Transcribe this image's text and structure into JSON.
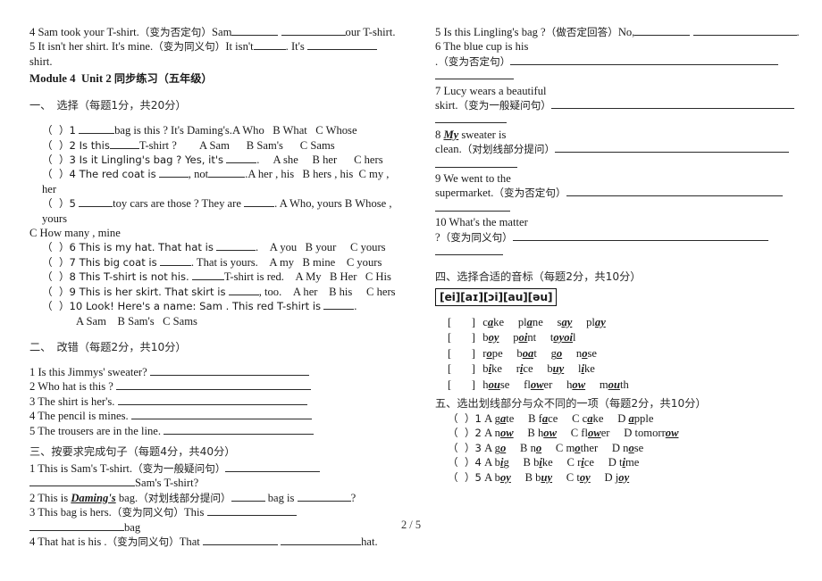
{
  "document": {
    "footer": "2 / 5",
    "title": {
      "module": "Module 4  Unit 2 ",
      "module_cn": "同步练习（五年级）"
    }
  },
  "carryover": {
    "item4": {
      "text_a": "4 Sam took your T-shirt.",
      "cn": "（变为否定句）",
      "text_b": "Sam",
      "text_c": "our T-shirt."
    },
    "item5": {
      "text_a": "5 It isn't her shirt. It's mine.",
      "cn": "（变为同义句）",
      "text_b": "It isn't",
      "text_c": ". It's",
      "text_d": "shirt."
    }
  },
  "section_one": {
    "heading_cn": "一、",
    "heading_title_cn": "选择（每题1分，共20分）",
    "items": [
      {
        "prefix": "（  ）1",
        "stem_a": "bag is this ? It's Daming's.",
        "options": "A Who   B What   C Whose"
      },
      {
        "prefix": "（  ）2 Is this",
        "stem_a": "T-shirt ?",
        "options": "A Sam      B Sam's      C Sams"
      },
      {
        "prefix": "（  ）3 Is it Lingling's bag ? Yes, it's",
        "stem_a": ".",
        "options": "A she     B her      C hers"
      },
      {
        "prefix": "（  ）4 The red coat is",
        "stem_a": ", not",
        "stem_b": ".",
        "options": "A her , his   B hers , his  C my , her"
      },
      {
        "prefix": "（  ）5",
        "stem_a": "toy cars are those ? They are",
        "stem_b": ".",
        "options": "A Who, yours B Whose , yours",
        "options_wrap": "C How many , mine"
      },
      {
        "prefix": "（  ）6 This is my hat. That hat is",
        "stem_a": ".",
        "options": "A you   B your     C yours"
      },
      {
        "prefix": "（  ）7 This big coat is",
        "stem_a": ". That is yours.",
        "options": "A my   B mine    C yours"
      },
      {
        "prefix": "（  ）8 This T-shirt is not his.",
        "stem_a": "T-shirt is red.",
        "options": "A My   B Her   C His"
      },
      {
        "prefix": "（  ）9 This is her skirt. That skirt is",
        "stem_a": ", too.",
        "options": "A her    B his     C hers"
      },
      {
        "prefix": "（  ）10 Look! Here's a name: Sam . This red T-shirt is",
        "stem_a": ".",
        "options": "A Sam    B Sam's   C Sams"
      }
    ]
  },
  "section_two": {
    "heading_cn": "二、",
    "heading_title_cn": "改错（每题2分，共10分）",
    "items": [
      "1 Is this Jimmys' sweater?",
      "2 Who hat is this ?",
      "3 The shirt is her's.",
      "4 The pencil is mines.",
      "5 The trousers are in the line."
    ]
  },
  "section_three": {
    "heading_cn": "三、按要求完成句子（每题4分，共40分）",
    "items": [
      {
        "num": "1 This is Sam's T-shirt.",
        "cn": "（变为一般疑问句）",
        "tail": "Sam's T-shirt?"
      },
      {
        "num": "2 This is ",
        "emph": "Daming's",
        "num_b": " bag.",
        "cn": "（对划线部分提问）",
        "mid": "bag is",
        "tail": "?"
      },
      {
        "num": "3 This bag is hers.",
        "cn": "（变为同义句）",
        "lead": "This",
        "tail": "bag"
      },
      {
        "num": "4 That hat is his .",
        "cn": "（变为同义句）",
        "lead": "That",
        "tail": "hat."
      },
      {
        "num": "5 Is this Lingling's bag ?",
        "cn": "（做否定回答）",
        "lead": "No,",
        "tail": "."
      },
      {
        "num": "6 The blue cup is his",
        "num_b": ".",
        "cn": "（变为否定句）"
      },
      {
        "num": "7 Lucy wears a beautiful",
        "num_b": "skirt.",
        "cn": "（变为一般疑问句）"
      },
      {
        "num": "8 ",
        "emph": "My",
        "num_b": " sweater is",
        "num_c": "clean.",
        "cn": "（对划线部分提问）"
      },
      {
        "num": "9 We went to the",
        "num_b": "supermarket.",
        "cn": "（变为否定句）"
      },
      {
        "num": "10 What's the matter",
        "num_b": "?",
        "cn": "（变为同义句）"
      }
    ]
  },
  "section_four": {
    "heading_cn": "四、选择合适的音标（每题2分，共10分）",
    "ipa_box": "[ei][aɪ][ɔi][au][əu]",
    "rows": [
      {
        "bracket": "[    ]",
        "words": [
          {
            "pre": "c",
            "mid": "a",
            "post": "ke"
          },
          {
            "pre": "pl",
            "mid": "a",
            "post": "ne"
          },
          {
            "pre": "s",
            "mid": "ay",
            "post": ""
          },
          {
            "pre": "pl",
            "mid": "ay",
            "post": ""
          }
        ]
      },
      {
        "bracket": "[    ]",
        "words": [
          {
            "pre": "b",
            "mid": "oy",
            "post": ""
          },
          {
            "pre": "p",
            "mid": "oi",
            "post": "nt"
          },
          {
            "pre": "t",
            "mid": "oyoi",
            "post": "l"
          }
        ]
      },
      {
        "bracket": "[    ]",
        "words": [
          {
            "pre": "r",
            "mid": "o",
            "post": "pe"
          },
          {
            "pre": "b",
            "mid": "oa",
            "post": "t"
          },
          {
            "pre": "g",
            "mid": "o",
            "post": ""
          },
          {
            "pre": "n",
            "mid": "o",
            "post": "se"
          }
        ]
      },
      {
        "bracket": "[    ]",
        "words": [
          {
            "pre": "b",
            "mid": "i",
            "post": "ke"
          },
          {
            "pre": "r",
            "mid": "i",
            "post": "ce"
          },
          {
            "pre": "b",
            "mid": "uy",
            "post": ""
          },
          {
            "pre": "l",
            "mid": "i",
            "post": "ke"
          }
        ]
      },
      {
        "bracket": "[    ]",
        "words": [
          {
            "pre": "h",
            "mid": "ou",
            "post": "se"
          },
          {
            "pre": "fl",
            "mid": "ow",
            "post": "er"
          },
          {
            "pre": "h",
            "mid": "ow",
            "post": ""
          },
          {
            "pre": "m",
            "mid": "ou",
            "post": "th"
          }
        ]
      }
    ]
  },
  "section_five": {
    "heading_cn": "五、选出划线部分与众不同的一项（每题2分，共10分）",
    "items": [
      {
        "prefix": "（  ）1",
        "options": [
          {
            "label": "A",
            "pre": "g",
            "mid": "a",
            "post": "te"
          },
          {
            "label": "B",
            "pre": "f",
            "mid": "a",
            "post": "ce"
          },
          {
            "label": "C",
            "pre": "c",
            "mid": "a",
            "post": "ke"
          },
          {
            "label": "D",
            "pre": "",
            "mid": "a",
            "post": "pple"
          }
        ]
      },
      {
        "prefix": "（  ）2",
        "options": [
          {
            "label": "A",
            "pre": "n",
            "mid": "ow",
            "post": ""
          },
          {
            "label": "B",
            "pre": "h",
            "mid": "ow",
            "post": ""
          },
          {
            "label": "C",
            "pre": "fl",
            "mid": "ow",
            "post": "er"
          },
          {
            "label": "D",
            "pre": "tomorr",
            "mid": "ow",
            "post": ""
          }
        ]
      },
      {
        "prefix": "（  ）3",
        "options": [
          {
            "label": "A",
            "pre": "g",
            "mid": "o",
            "post": ""
          },
          {
            "label": "B",
            "pre": "n",
            "mid": "o",
            "post": ""
          },
          {
            "label": "C",
            "pre": "m",
            "mid": "o",
            "post": "ther"
          },
          {
            "label": "D",
            "pre": "n",
            "mid": "o",
            "post": "se"
          }
        ]
      },
      {
        "prefix": "（  ）4",
        "options": [
          {
            "label": "A",
            "pre": "b",
            "mid": "i",
            "post": "g"
          },
          {
            "label": "B",
            "pre": "b",
            "mid": "i",
            "post": "ke"
          },
          {
            "label": "C",
            "pre": "r",
            "mid": "i",
            "post": "ce"
          },
          {
            "label": "D",
            "pre": "t",
            "mid": "i",
            "post": "me"
          }
        ]
      },
      {
        "prefix": "（  ）5",
        "options": [
          {
            "label": "A",
            "pre": "b",
            "mid": "oy",
            "post": ""
          },
          {
            "label": "B",
            "pre": "b",
            "mid": "uy",
            "post": ""
          },
          {
            "label": "C",
            "pre": "t",
            "mid": "oy",
            "post": ""
          },
          {
            "label": "D",
            "pre": "j",
            "mid": "oy",
            "post": ""
          }
        ]
      }
    ]
  }
}
